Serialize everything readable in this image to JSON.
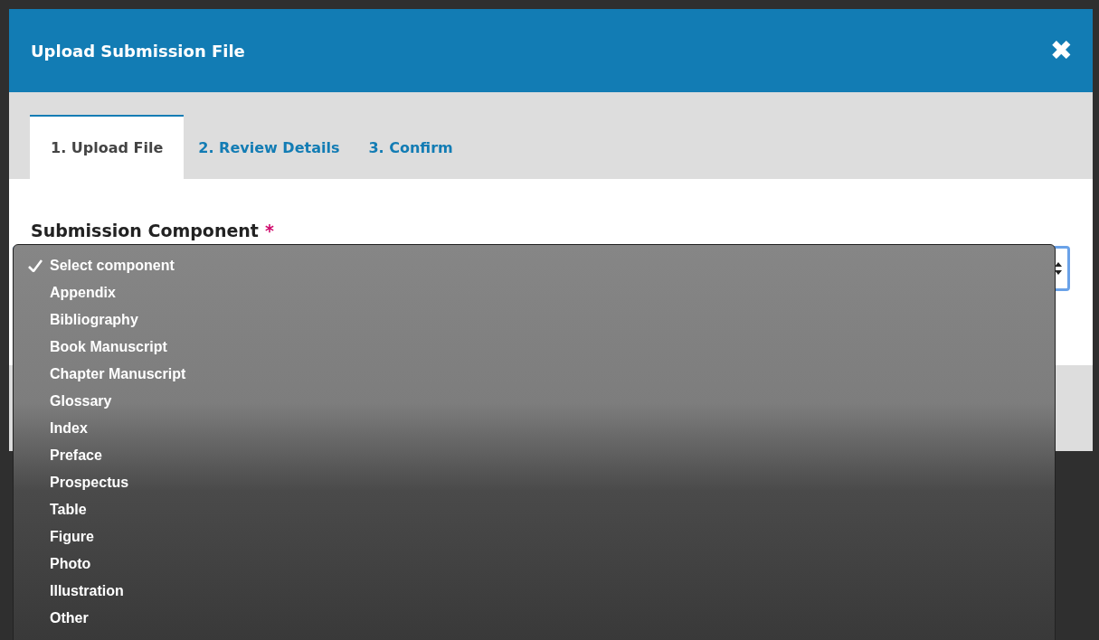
{
  "modal": {
    "title": "Upload Submission File",
    "close_icon": "✖"
  },
  "tabs": [
    {
      "label": "1. Upload File",
      "selected": true
    },
    {
      "label": "2. Review Details",
      "selected": false
    },
    {
      "label": "3. Confirm",
      "selected": false
    }
  ],
  "field": {
    "label": "Submission Component",
    "required_mark": "*",
    "focused": true
  },
  "dropdown": {
    "items": [
      {
        "label": "Select component",
        "selected": true
      },
      {
        "label": "Appendix",
        "selected": false
      },
      {
        "label": "Bibliography",
        "selected": false
      },
      {
        "label": "Book Manuscript",
        "selected": false
      },
      {
        "label": "Chapter Manuscript",
        "selected": false
      },
      {
        "label": "Glossary",
        "selected": false
      },
      {
        "label": "Index",
        "selected": false
      },
      {
        "label": "Preface",
        "selected": false
      },
      {
        "label": "Prospectus",
        "selected": false
      },
      {
        "label": "Table",
        "selected": false
      },
      {
        "label": "Figure",
        "selected": false
      },
      {
        "label": "Photo",
        "selected": false
      },
      {
        "label": "Illustration",
        "selected": false
      },
      {
        "label": "Other",
        "selected": false
      }
    ]
  }
}
